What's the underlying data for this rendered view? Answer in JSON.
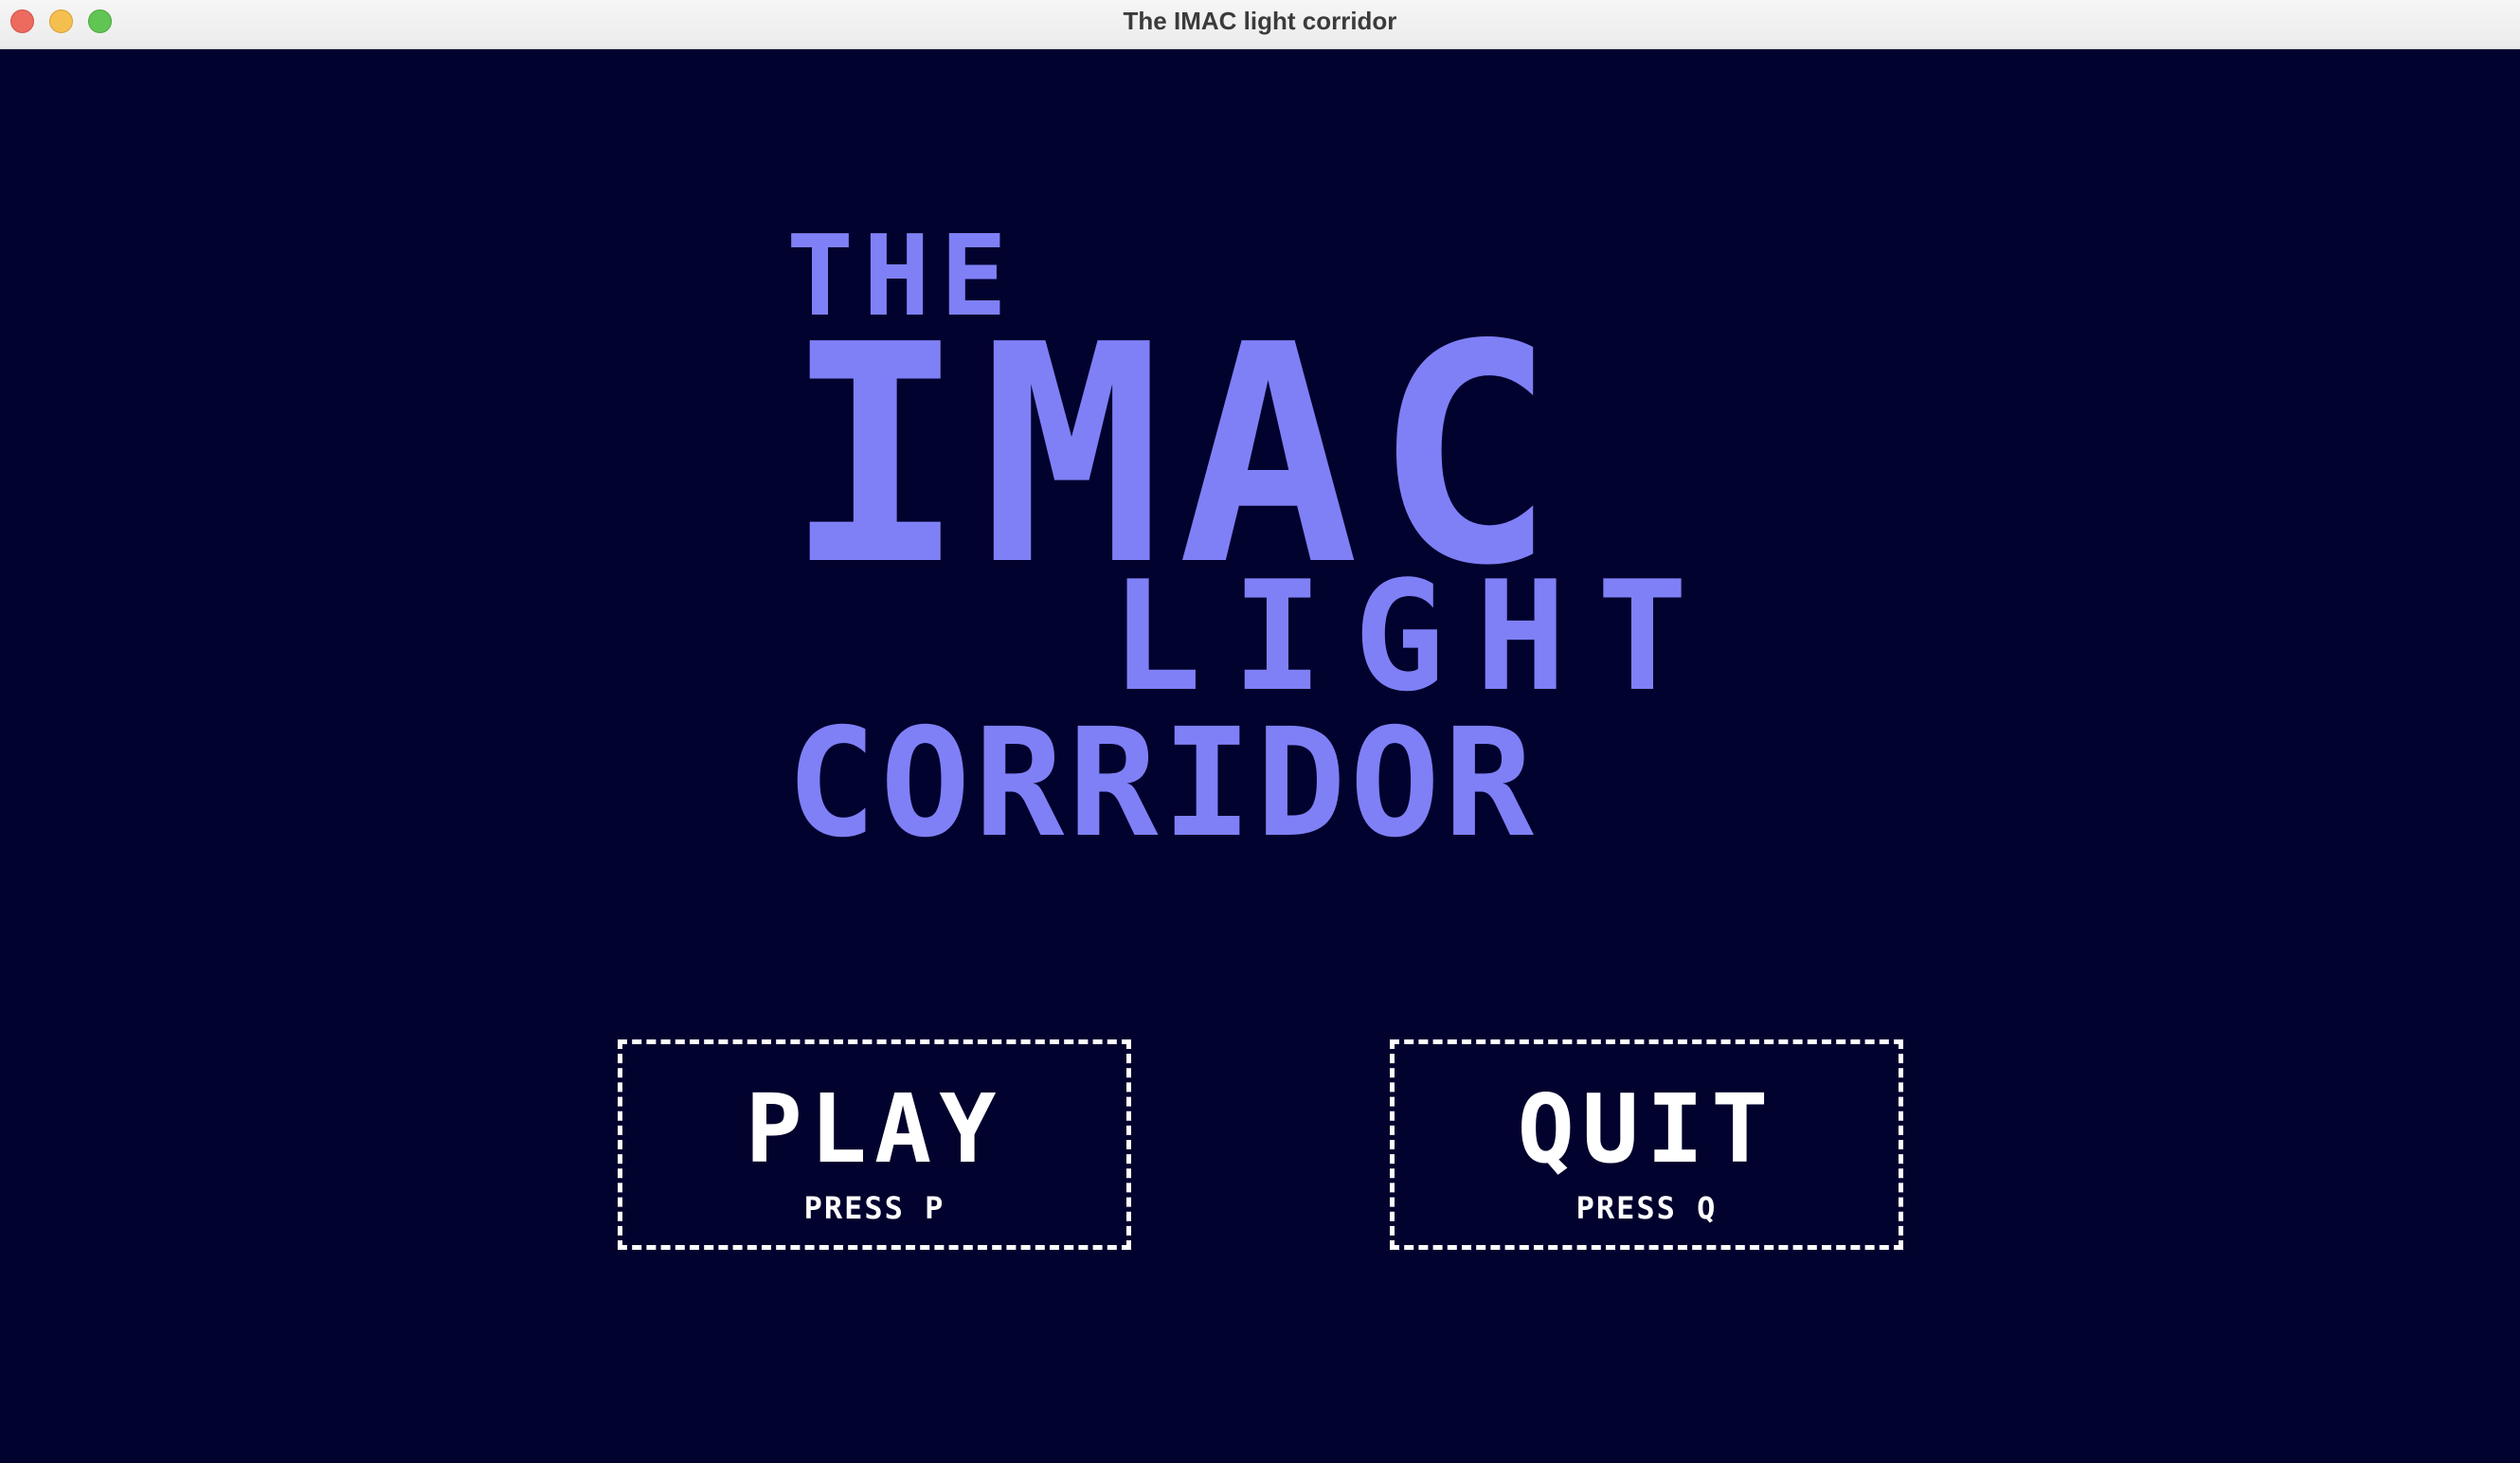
{
  "window": {
    "title": "The IMAC light corridor"
  },
  "logo": {
    "line1": "THE",
    "line2": "IMAC",
    "line3": "LIGHT",
    "line4": "CORRIDOR",
    "color": "#7f80f6"
  },
  "menu": {
    "play": {
      "label": "PLAY",
      "hint": "PRESS P"
    },
    "quit": {
      "label": "QUIT",
      "hint": "PRESS Q"
    }
  },
  "colors": {
    "background": "#02022e",
    "menu_text": "#ffffff"
  }
}
